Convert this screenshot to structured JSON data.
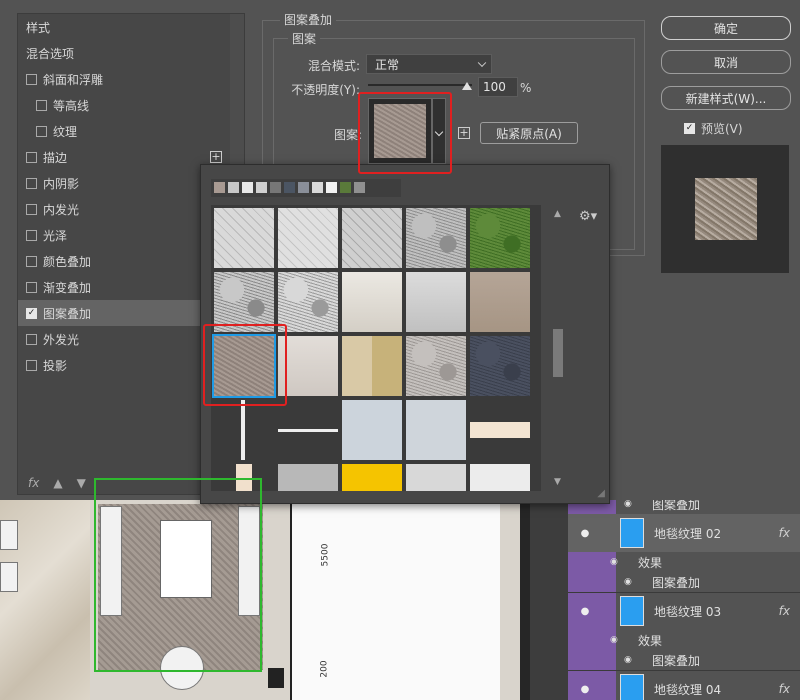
{
  "left_panel": {
    "items": [
      {
        "label": "样式",
        "checkbox": false,
        "checked": false,
        "indent": 0,
        "selected": false,
        "plus": false
      },
      {
        "label": "混合选项",
        "checkbox": false,
        "checked": false,
        "indent": 0,
        "selected": false,
        "plus": false
      },
      {
        "label": "斜面和浮雕",
        "checkbox": true,
        "checked": false,
        "indent": 0,
        "selected": false,
        "plus": false
      },
      {
        "label": "等高线",
        "checkbox": true,
        "checked": false,
        "indent": 1,
        "selected": false,
        "plus": false
      },
      {
        "label": "纹理",
        "checkbox": true,
        "checked": false,
        "indent": 1,
        "selected": false,
        "plus": false
      },
      {
        "label": "描边",
        "checkbox": true,
        "checked": false,
        "indent": 0,
        "selected": false,
        "plus": true
      },
      {
        "label": "内阴影",
        "checkbox": true,
        "checked": false,
        "indent": 0,
        "selected": false,
        "plus": false
      },
      {
        "label": "内发光",
        "checkbox": true,
        "checked": false,
        "indent": 0,
        "selected": false,
        "plus": false
      },
      {
        "label": "光泽",
        "checkbox": true,
        "checked": false,
        "indent": 0,
        "selected": false,
        "plus": false
      },
      {
        "label": "颜色叠加",
        "checkbox": true,
        "checked": false,
        "indent": 0,
        "selected": false,
        "plus": false
      },
      {
        "label": "渐变叠加",
        "checkbox": true,
        "checked": false,
        "indent": 0,
        "selected": false,
        "plus": false
      },
      {
        "label": "图案叠加",
        "checkbox": true,
        "checked": true,
        "indent": 0,
        "selected": true,
        "plus": false
      },
      {
        "label": "外发光",
        "checkbox": true,
        "checked": false,
        "indent": 0,
        "selected": false,
        "plus": false
      },
      {
        "label": "投影",
        "checkbox": true,
        "checked": false,
        "indent": 0,
        "selected": false,
        "plus": false
      }
    ],
    "fx_label": "fx",
    "up_icon": "arrow-up-icon",
    "down_icon": "arrow-down-icon"
  },
  "pattern_overlay": {
    "section_title": "图案叠加",
    "group_title": "图案",
    "blend_mode_label": "混合模式:",
    "blend_mode_value": "正常",
    "opacity_label": "不透明度(Y):",
    "opacity_value": "100",
    "opacity_unit": "%",
    "opacity_level": 1.0,
    "pattern_label": "图案:",
    "snap_button": "贴紧原点(A)"
  },
  "buttons": {
    "ok": "确定",
    "cancel": "取消",
    "new_style": "新建样式(W)...",
    "preview_label": "预览(V)",
    "preview_checked": true
  },
  "popup": {
    "mini_swatches": [
      "#a89a92",
      "#c8c8c8",
      "#e8e8e8",
      "#d0d0d0",
      "#777777",
      "#4b5563",
      "#8a8f99",
      "#d9d9d9",
      "#f2f2f2",
      "#5a7a3a",
      "#909090"
    ],
    "tiles": [
      {
        "name": "herringbone-white",
        "row": 0,
        "col": 0,
        "c1": "#d9d9d9",
        "c2": "#b9b9b9",
        "style": "herringbone"
      },
      {
        "name": "herringbone-light",
        "row": 0,
        "col": 1,
        "c1": "#e0e0e0",
        "c2": "#c4c4c4",
        "style": "herringbone"
      },
      {
        "name": "herringbone-marble",
        "row": 0,
        "col": 2,
        "c1": "#cfcfcf",
        "c2": "#a9a9a9",
        "style": "herringbone"
      },
      {
        "name": "gray-granite",
        "row": 0,
        "col": 3,
        "c1": "#bfbfbf",
        "c2": "#8e8e8e",
        "style": "noise"
      },
      {
        "name": "green-grass",
        "row": 0,
        "col": 4,
        "c1": "#5e8a3a",
        "c2": "#3f6e24",
        "style": "noise"
      },
      {
        "name": "terrazzo-gray",
        "row": 1,
        "col": 0,
        "c1": "#c8c8c8",
        "c2": "#8a8a8a",
        "style": "noise"
      },
      {
        "name": "terrazzo-light",
        "row": 1,
        "col": 1,
        "c1": "#d8d8d8",
        "c2": "#9a9a9a",
        "style": "noise"
      },
      {
        "name": "beige-marble",
        "row": 1,
        "col": 2,
        "c1": "#ebe8e2",
        "c2": "#d4cfc6",
        "style": "flat"
      },
      {
        "name": "white-stone",
        "row": 1,
        "col": 3,
        "c1": "#dcdcdc",
        "c2": "#c0c0c0",
        "style": "flat"
      },
      {
        "name": "tan-fabric",
        "row": 1,
        "col": 4,
        "c1": "#b5a597",
        "c2": "#a69584",
        "style": "flat"
      },
      {
        "name": "carpet-taupe",
        "row": 2,
        "col": 0,
        "c1": "#a79a92",
        "c2": "#8e817a",
        "style": "carpet"
      },
      {
        "name": "light-wood",
        "row": 2,
        "col": 1,
        "c1": "#e2ddd8",
        "c2": "#cfc8c2",
        "style": "flat"
      },
      {
        "name": "geometric-yellow",
        "row": 2,
        "col": 2,
        "c1": "#d9c9a6",
        "c2": "#c7b27a",
        "style": "geo"
      },
      {
        "name": "gray-concrete",
        "row": 2,
        "col": 3,
        "c1": "#c4c0bd",
        "c2": "#9d9895",
        "style": "noise"
      },
      {
        "name": "navy-fabric",
        "row": 2,
        "col": 4,
        "c1": "#4a5060",
        "c2": "#3a3f4c",
        "style": "noise"
      },
      {
        "name": "dark-line-v",
        "row": 3,
        "col": 0,
        "c1": "#3a3a3a",
        "c2": "#3a3a3a",
        "style": "vline"
      },
      {
        "name": "dark-line-h",
        "row": 3,
        "col": 1,
        "c1": "#3a3a3a",
        "c2": "#3a3a3a",
        "style": "hline"
      },
      {
        "name": "pale-blue-gray",
        "row": 3,
        "col": 2,
        "c1": "#ccd4dc",
        "c2": "#ccd4dc",
        "style": "flat"
      },
      {
        "name": "light-blue-gray",
        "row": 3,
        "col": 3,
        "c1": "#cfd5db",
        "c2": "#cfd5db",
        "style": "flat"
      },
      {
        "name": "cream-tile",
        "row": 3,
        "col": 4,
        "c1": "#f3e4d2",
        "c2": "#3a3a3a",
        "style": "halfcream"
      },
      {
        "name": "cream-small",
        "row": 4,
        "col": 0,
        "c1": "#f1e0cc",
        "c2": "#3a3a3a",
        "style": "smallcream"
      },
      {
        "name": "mid-gray",
        "row": 4,
        "col": 1,
        "c1": "#b8b8b8",
        "c2": "#b8b8b8",
        "style": "flat"
      },
      {
        "name": "yellow",
        "row": 4,
        "col": 2,
        "c1": "#f5c400",
        "c2": "#f5c400",
        "style": "flat"
      },
      {
        "name": "silver",
        "row": 4,
        "col": 3,
        "c1": "#d8d8d8",
        "c2": "#d8d8d8",
        "style": "flat"
      },
      {
        "name": "off-white",
        "row": 4,
        "col": 4,
        "c1": "#ececec",
        "c2": "#ececec",
        "style": "flat"
      }
    ],
    "selected_tile": 10,
    "gear_icon": "gear-icon"
  },
  "layers": {
    "rows": [
      {
        "type": "effect",
        "label": "图案叠加",
        "eye": true
      },
      {
        "type": "layer",
        "label": "地毯纹理 02",
        "fx": "fx",
        "selected": true
      },
      {
        "type": "effects",
        "label": "效果"
      },
      {
        "type": "effect",
        "label": "图案叠加",
        "eye": true
      },
      {
        "type": "layer",
        "label": "地毯纹理 03",
        "fx": "fx"
      },
      {
        "type": "effects",
        "label": "效果"
      },
      {
        "type": "effect",
        "label": "图案叠加",
        "eye": true
      },
      {
        "type": "layer",
        "label": "地毯纹理 04",
        "fx": "fx"
      }
    ]
  },
  "canvas": {
    "dim_5500": "5500",
    "dim_200": "200"
  },
  "colors": {
    "highlight_red": "#e02020",
    "highlight_green": "#2eb82e",
    "selection_blue": "#1e9be6",
    "layer_strip": "#7c5aa6"
  }
}
